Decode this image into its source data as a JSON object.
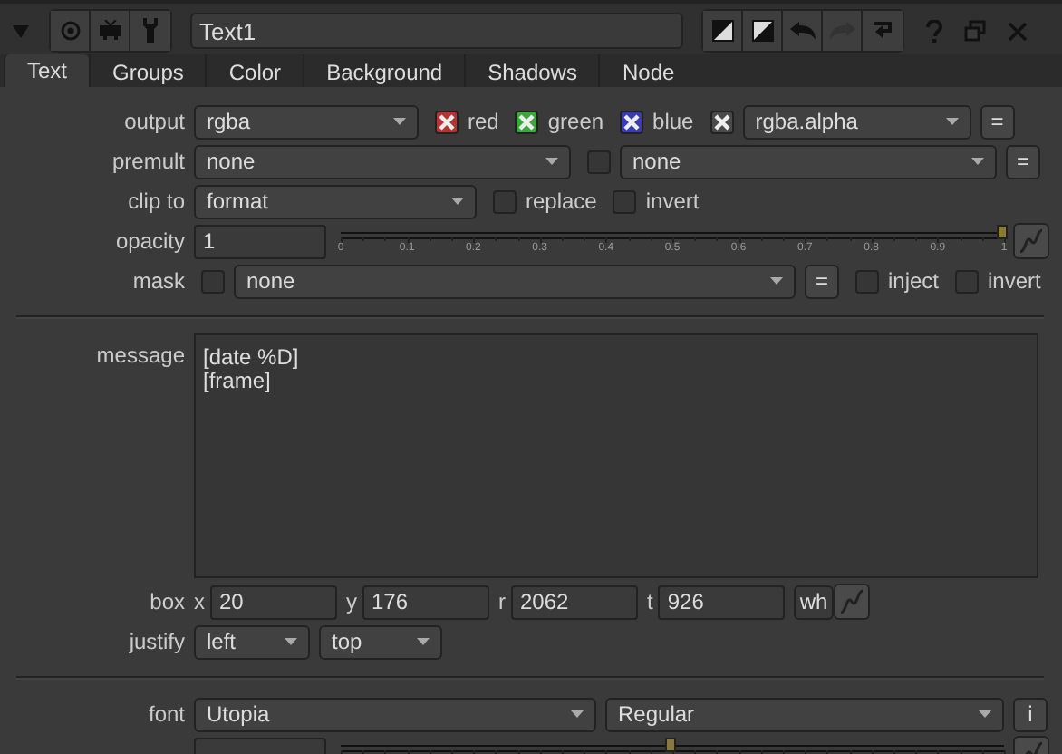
{
  "header": {
    "node_name": "Text1"
  },
  "tabs": [
    {
      "label": "Text",
      "selected": true
    },
    {
      "label": "Groups",
      "selected": false
    },
    {
      "label": "Color",
      "selected": false
    },
    {
      "label": "Background",
      "selected": false
    },
    {
      "label": "Shadows",
      "selected": false
    },
    {
      "label": "Node",
      "selected": false
    }
  ],
  "output": {
    "label": "output",
    "value": "rgba",
    "channels": [
      {
        "label": "red",
        "checked": true,
        "color": "#b83232"
      },
      {
        "label": "green",
        "checked": true,
        "color": "#3aa83a"
      },
      {
        "label": "blue",
        "checked": true,
        "color": "#3a3ab8"
      },
      {
        "checked": true,
        "color": "#4a4a4a"
      }
    ],
    "alpha_value": "rgba.alpha",
    "link": "="
  },
  "premult": {
    "label": "premult",
    "value": "none",
    "checked": false,
    "value_2": "none",
    "link": "="
  },
  "clip_to": {
    "label": "clip to",
    "value": "format",
    "options": [
      {
        "label": "replace",
        "checked": false
      },
      {
        "label": "invert",
        "checked": false
      }
    ]
  },
  "opacity": {
    "label": "opacity",
    "value": "1",
    "level": 1,
    "ticks": [
      "0",
      "0.1",
      "0.2",
      "0.3",
      "0.4",
      "0.5",
      "0.6",
      "0.7",
      "0.8",
      "0.9",
      "1"
    ]
  },
  "mask": {
    "label": "mask",
    "checked": false,
    "value": "none",
    "link": "=",
    "options": [
      {
        "label": "inject",
        "checked": false
      },
      {
        "label": "invert",
        "checked": false
      }
    ]
  },
  "message": {
    "label": "message",
    "value": "[date %D]\n[frame]"
  },
  "box": {
    "label": "box",
    "fields": [
      {
        "axis": "x",
        "value": "20"
      },
      {
        "axis": "y",
        "value": "176"
      },
      {
        "axis": "r",
        "value": "2062"
      },
      {
        "axis": "t",
        "value": "926"
      }
    ],
    "wh_label": "wh"
  },
  "justify": {
    "label": "justify",
    "horizontal": "left",
    "vertical": "top"
  },
  "font": {
    "label": "font",
    "family": "Utopia",
    "style": "Regular",
    "info": "i"
  },
  "global_font_scale": {
    "level": 0.5
  }
}
